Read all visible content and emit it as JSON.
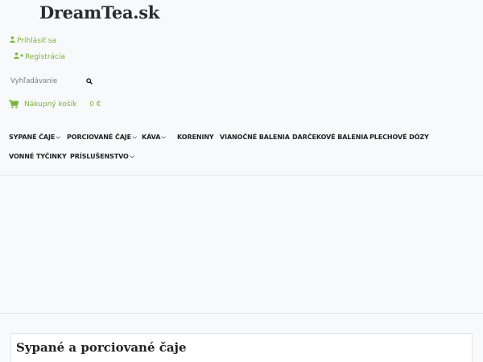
{
  "header": {
    "logo": "DreamTea.sk"
  },
  "account": {
    "login_label": "Prihlásiť sa",
    "login_icon": "user-icon",
    "register_label": "Registrácia",
    "register_icon": "user-plus-icon"
  },
  "search": {
    "placeholder": "Vyhľadávanie",
    "icon": "search-icon"
  },
  "cart": {
    "label": "Nákupný košík",
    "total": "0 €",
    "icon": "cart-icon"
  },
  "nav": {
    "items": [
      {
        "label": "SYPANÉ ČAJE",
        "dropdown": true
      },
      {
        "label": "PORCIOVANÉ ČAJE",
        "dropdown": true
      },
      {
        "label": "KÁVA",
        "dropdown": true
      },
      {
        "label": "KORENINY",
        "dropdown": false
      },
      {
        "label": "VIANOČNÉ BALENIA",
        "dropdown": false
      },
      {
        "label": "DARČEKOVÉ BALENIA",
        "dropdown": false
      },
      {
        "label": "PLECHOVÉ DÓZY",
        "dropdown": false
      },
      {
        "label": "VONNÉ TYČINKY",
        "dropdown": false
      },
      {
        "label": "PRÍSLUŠENSTVO",
        "dropdown": true
      }
    ]
  },
  "section": {
    "title": "Sypané a porciované čaje"
  },
  "colors": {
    "accent": "#79b33a",
    "background": "#f8f9fb"
  }
}
